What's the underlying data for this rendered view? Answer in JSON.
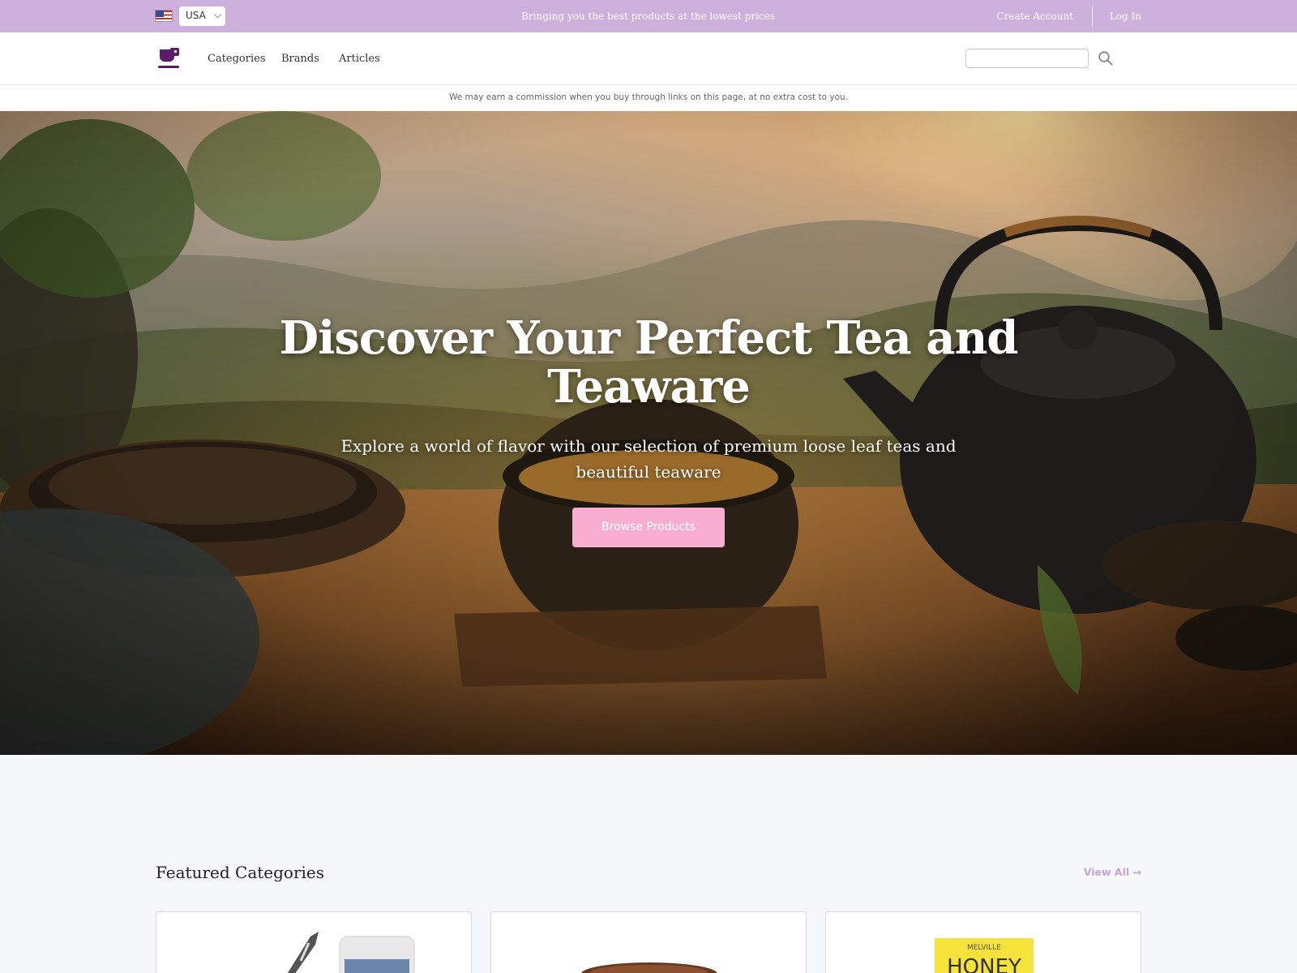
{
  "topbar": {
    "country": "USA",
    "promo": "Bringing you the best products at the lowest prices",
    "create_account": "Create Account",
    "log_in": "Log In"
  },
  "nav": {
    "links": [
      "Categories",
      "Brands",
      "Articles"
    ],
    "search_placeholder": ""
  },
  "disclaimer": "We may earn a commission when you buy through links on this page, at no extra cost to you.",
  "hero": {
    "title": "Discover Your Perfect Tea and Teaware",
    "subtitle": "Explore a world of flavor with our selection of premium loose leaf teas and beautiful teaware",
    "button": "Browse Products"
  },
  "featured": {
    "title": "Featured Categories",
    "view_all": "View All →",
    "cards": [
      {
        "image": "tea-tools-thumbnail"
      },
      {
        "image": "teapot-thumbnail"
      },
      {
        "image": "honey-straws-thumbnail",
        "image_text": "MELVILLE HONEY"
      }
    ]
  },
  "colors": {
    "topbar": "#cdb1dc",
    "brand": "#5b1a6e",
    "button": "#f7aed0",
    "view_all": "#c7a4d8"
  }
}
